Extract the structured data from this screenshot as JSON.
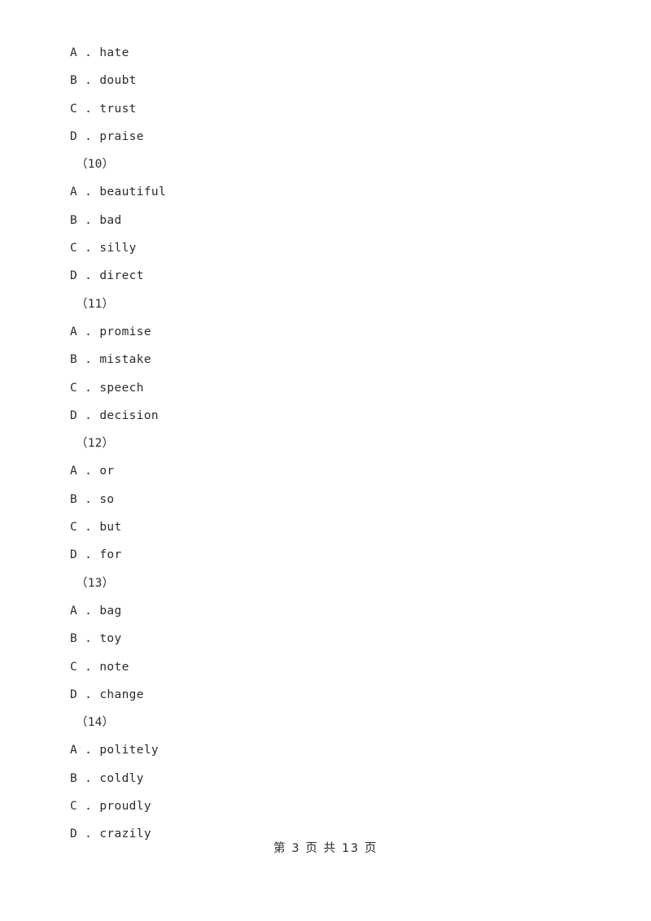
{
  "document": {
    "page_footer": "第 3 页 共 13 页",
    "option_separator": " . "
  },
  "blocks": [
    {
      "question_label": null,
      "options": [
        {
          "letter": "A",
          "text": "hate"
        },
        {
          "letter": "B",
          "text": "doubt"
        },
        {
          "letter": "C",
          "text": "trust"
        },
        {
          "letter": "D",
          "text": "praise"
        }
      ]
    },
    {
      "question_label": "（10）",
      "options": [
        {
          "letter": "A",
          "text": "beautiful"
        },
        {
          "letter": "B",
          "text": "bad"
        },
        {
          "letter": "C",
          "text": "silly"
        },
        {
          "letter": "D",
          "text": "direct"
        }
      ]
    },
    {
      "question_label": "（11）",
      "options": [
        {
          "letter": "A",
          "text": "promise"
        },
        {
          "letter": "B",
          "text": "mistake"
        },
        {
          "letter": "C",
          "text": "speech"
        },
        {
          "letter": "D",
          "text": "decision"
        }
      ]
    },
    {
      "question_label": "（12）",
      "options": [
        {
          "letter": "A",
          "text": "or"
        },
        {
          "letter": "B",
          "text": "so"
        },
        {
          "letter": "C",
          "text": "but"
        },
        {
          "letter": "D",
          "text": "for"
        }
      ]
    },
    {
      "question_label": "（13）",
      "options": [
        {
          "letter": "A",
          "text": "bag"
        },
        {
          "letter": "B",
          "text": "toy"
        },
        {
          "letter": "C",
          "text": "note"
        },
        {
          "letter": "D",
          "text": "change"
        }
      ]
    },
    {
      "question_label": "（14）",
      "options": [
        {
          "letter": "A",
          "text": "politely"
        },
        {
          "letter": "B",
          "text": "coldly"
        },
        {
          "letter": "C",
          "text": "proudly"
        },
        {
          "letter": "D",
          "text": "crazily"
        }
      ]
    }
  ]
}
